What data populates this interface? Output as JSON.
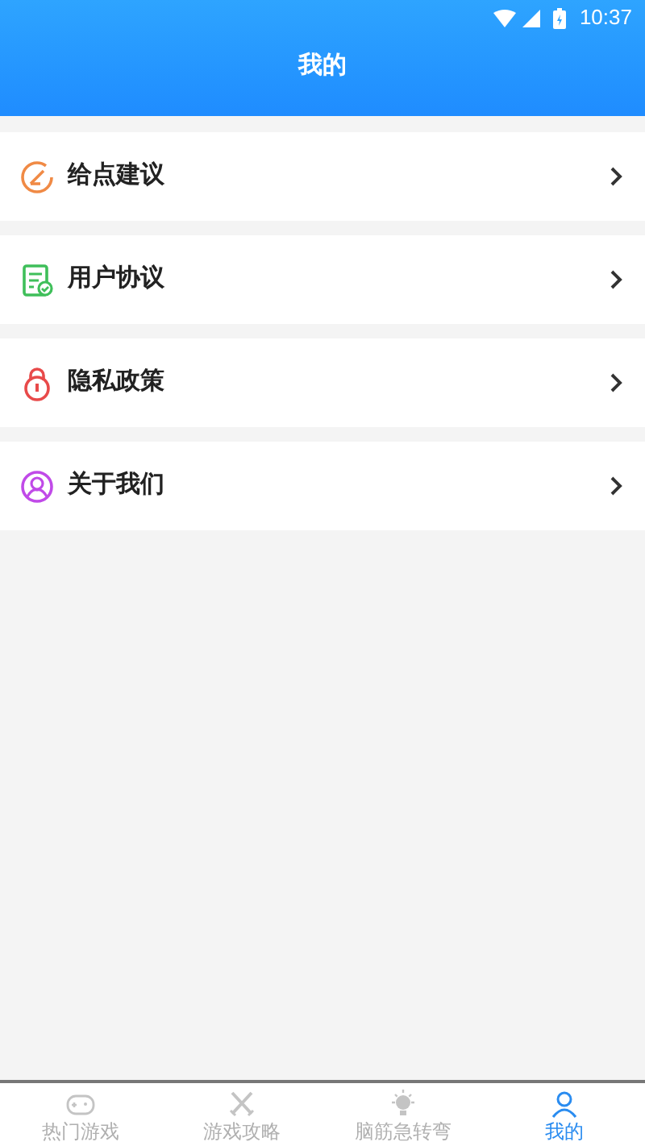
{
  "status_bar": {
    "time": "10:37"
  },
  "header": {
    "title": "我的"
  },
  "menu": [
    {
      "kind": "feedback",
      "label": "给点建议"
    },
    {
      "kind": "agreement",
      "label": "用户协议"
    },
    {
      "kind": "privacy",
      "label": "隐私政策"
    },
    {
      "kind": "about",
      "label": "关于我们"
    }
  ],
  "tab_bar": [
    {
      "kind": "games",
      "label": "热门游戏",
      "selected": false
    },
    {
      "kind": "guides",
      "label": "游戏攻略",
      "selected": false
    },
    {
      "kind": "riddles",
      "label": "脑筋急转弯",
      "selected": false
    },
    {
      "kind": "me",
      "label": "我的",
      "selected": true
    }
  ]
}
